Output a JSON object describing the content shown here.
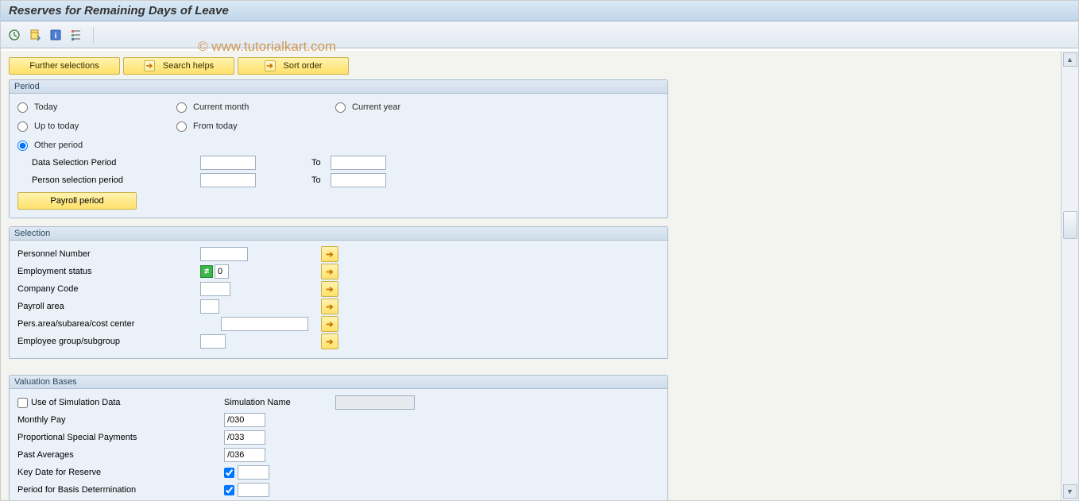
{
  "title": "Reserves for Remaining Days of Leave",
  "watermark": "© www.tutorialkart.com",
  "top_buttons": {
    "further_selections": "Further selections",
    "search_helps": "Search helps",
    "sort_order": "Sort order"
  },
  "period": {
    "title": "Period",
    "today": "Today",
    "current_month": "Current month",
    "current_year": "Current year",
    "up_to_today": "Up to today",
    "from_today": "From today",
    "other_period": "Other period",
    "data_selection_period": "Data Selection Period",
    "person_selection_period": "Person selection period",
    "to": "To",
    "payroll_period": "Payroll period"
  },
  "selection": {
    "title": "Selection",
    "personnel_number": "Personnel Number",
    "employment_status": "Employment status",
    "employment_status_val": "0",
    "company_code": "Company Code",
    "payroll_area": "Payroll area",
    "pers_area": "Pers.area/subarea/cost center",
    "employee_group": "Employee group/subgroup"
  },
  "valuation": {
    "title": "Valuation Bases",
    "use_simulation": "Use of Simulation Data",
    "simulation_name": "Simulation Name",
    "monthly_pay": "Monthly Pay",
    "monthly_pay_val": "/030",
    "prop_special": "Proportional Special Payments",
    "prop_special_val": "/033",
    "past_averages": "Past Averages",
    "past_averages_val": "/036",
    "key_date": "Key Date for Reserve",
    "period_basis": "Period for Basis Determination"
  }
}
